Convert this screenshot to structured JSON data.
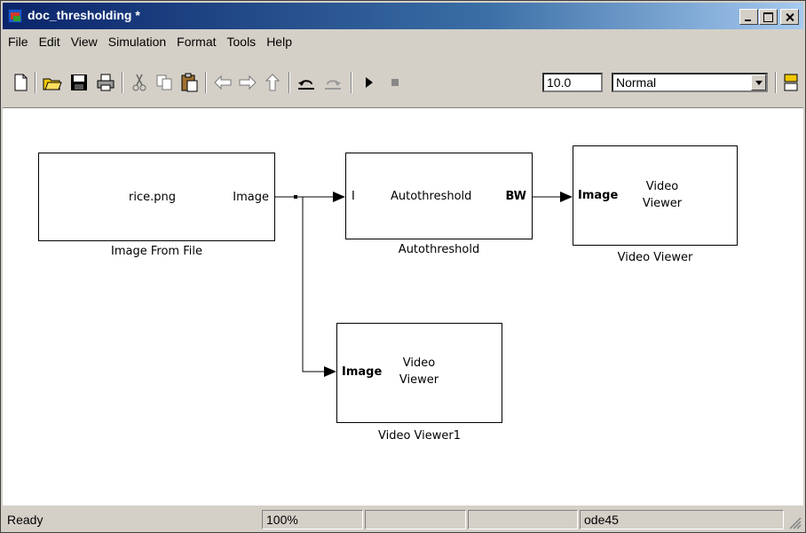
{
  "window": {
    "title": "doc_thresholding *"
  },
  "menu": {
    "items": [
      "File",
      "Edit",
      "View",
      "Simulation",
      "Format",
      "Tools",
      "Help"
    ]
  },
  "toolbar": {
    "stop_time": "10.0",
    "sim_mode": "Normal"
  },
  "blocks": {
    "image_from_file": {
      "content": "rice.png",
      "out_port": "Image",
      "name": "Image From File"
    },
    "autothreshold": {
      "in_port": "I",
      "content": "Autothreshold",
      "out_port": "BW",
      "name": "Autothreshold"
    },
    "video_viewer": {
      "in_port": "Image",
      "content_line1": "Video",
      "content_line2": "Viewer",
      "name": "Video Viewer"
    },
    "video_viewer1": {
      "in_port": "Image",
      "content_line1": "Video",
      "content_line2": "Viewer",
      "name": "Video Viewer1"
    }
  },
  "status": {
    "state": "Ready",
    "zoom": "100%",
    "solver": "ode45"
  },
  "colors": {
    "titlebar_start": "#0a246a",
    "titlebar_end": "#a6caf0",
    "chrome": "#d4d0c8"
  }
}
